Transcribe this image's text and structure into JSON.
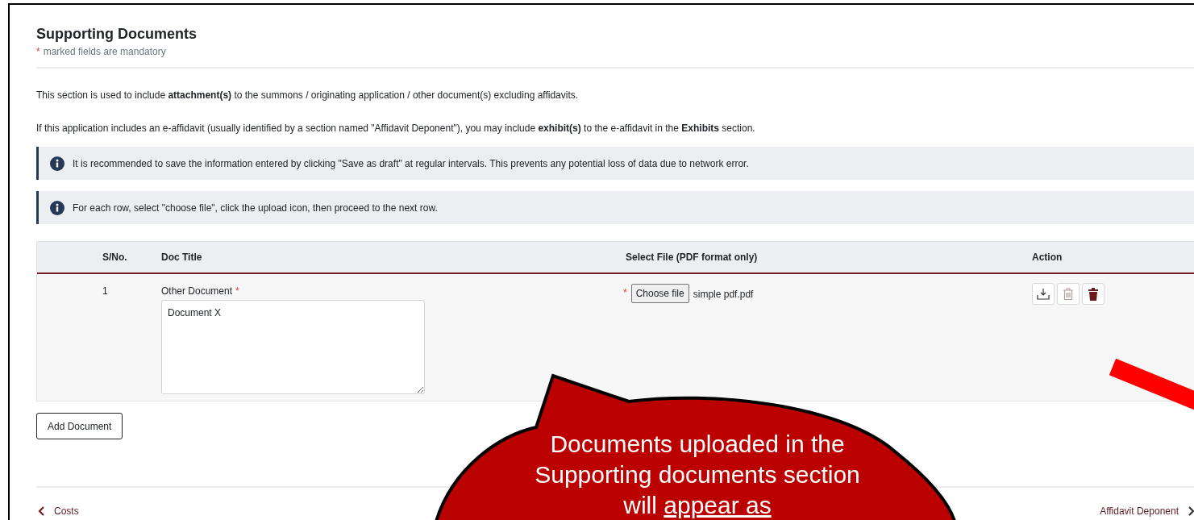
{
  "header": {
    "title": "Supporting Documents",
    "required_mark": "*",
    "subtitle": "marked fields are mandatory"
  },
  "paragraphs": [
    "This section is used to include **attachment(s)** to the summons / originating application / other document(s) excluding affidavits.",
    "If this application includes an e-affidavit (usually identified by a section named \"Affidavit Deponent\"), you may include **exhibit(s)** to the e-affidavit in the **Exhibits** section."
  ],
  "notices": [
    "It is recommended to save the information entered by clicking \"Save as draft\" at regular intervals. This prevents any potential loss of data due to network error.",
    "For each row, select \"choose file\", click the upload icon, then proceed to the next row."
  ],
  "table": {
    "columns": [
      "S/No.",
      "Doc Title",
      "Select File (PDF format only)",
      "Action"
    ],
    "rows": [
      {
        "sno": "1",
        "doc_label": "Other Document",
        "doc_required_mark": "*",
        "doc_value": "Document X",
        "file_required_mark": "*",
        "choose_button": "Choose file",
        "file_name": "simple pdf.pdf"
      }
    ]
  },
  "add_button": "Add Document",
  "nav": {
    "previous": "Costs",
    "next": "Affidavit Deponent"
  },
  "callout": {
    "text": "Documents uploaded in the Supporting documents section will",
    "underlined": "appear as"
  }
}
